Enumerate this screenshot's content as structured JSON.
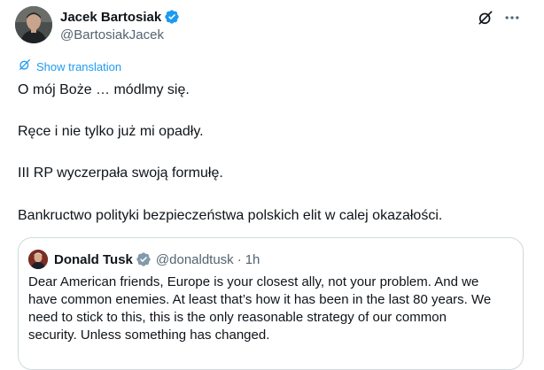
{
  "tweet": {
    "author": {
      "display_name": "Jacek Bartosiak",
      "handle": "@BartosiakJacek",
      "verified_icon": "verified-badge-icon"
    },
    "actions": {
      "grok_icon": "grok-icon",
      "more_icon": "more-dots-icon"
    },
    "translation": {
      "icon": "globe-icon",
      "label": "Show translation"
    },
    "body": {
      "line1": "O mój Boże … módlmy się.",
      "line2": "Ręce i nie tylko już mi opadły.",
      "line3": "III RP wyczerpała swoją formułę.",
      "line4": "Bankructwo polityki bezpieczeństwa polskich elit w calej okazałości."
    },
    "quote": {
      "display_name": "Donald Tusk",
      "handle": "@donaldtusk",
      "separator": "·",
      "time": "1h",
      "lines": [
        "Dear American friends, Europe is your closest ally, not your problem. And we",
        "have common enemies. At least that’s how it has been in the last 80 years. We",
        "need to stick to this, this is the only reasonable strategy of our common",
        "security. Unless something has changed."
      ]
    },
    "colors": {
      "accent": "#1d9bf0",
      "text": "#0f1419",
      "secondary": "#536471",
      "border": "#cfd9de"
    }
  }
}
